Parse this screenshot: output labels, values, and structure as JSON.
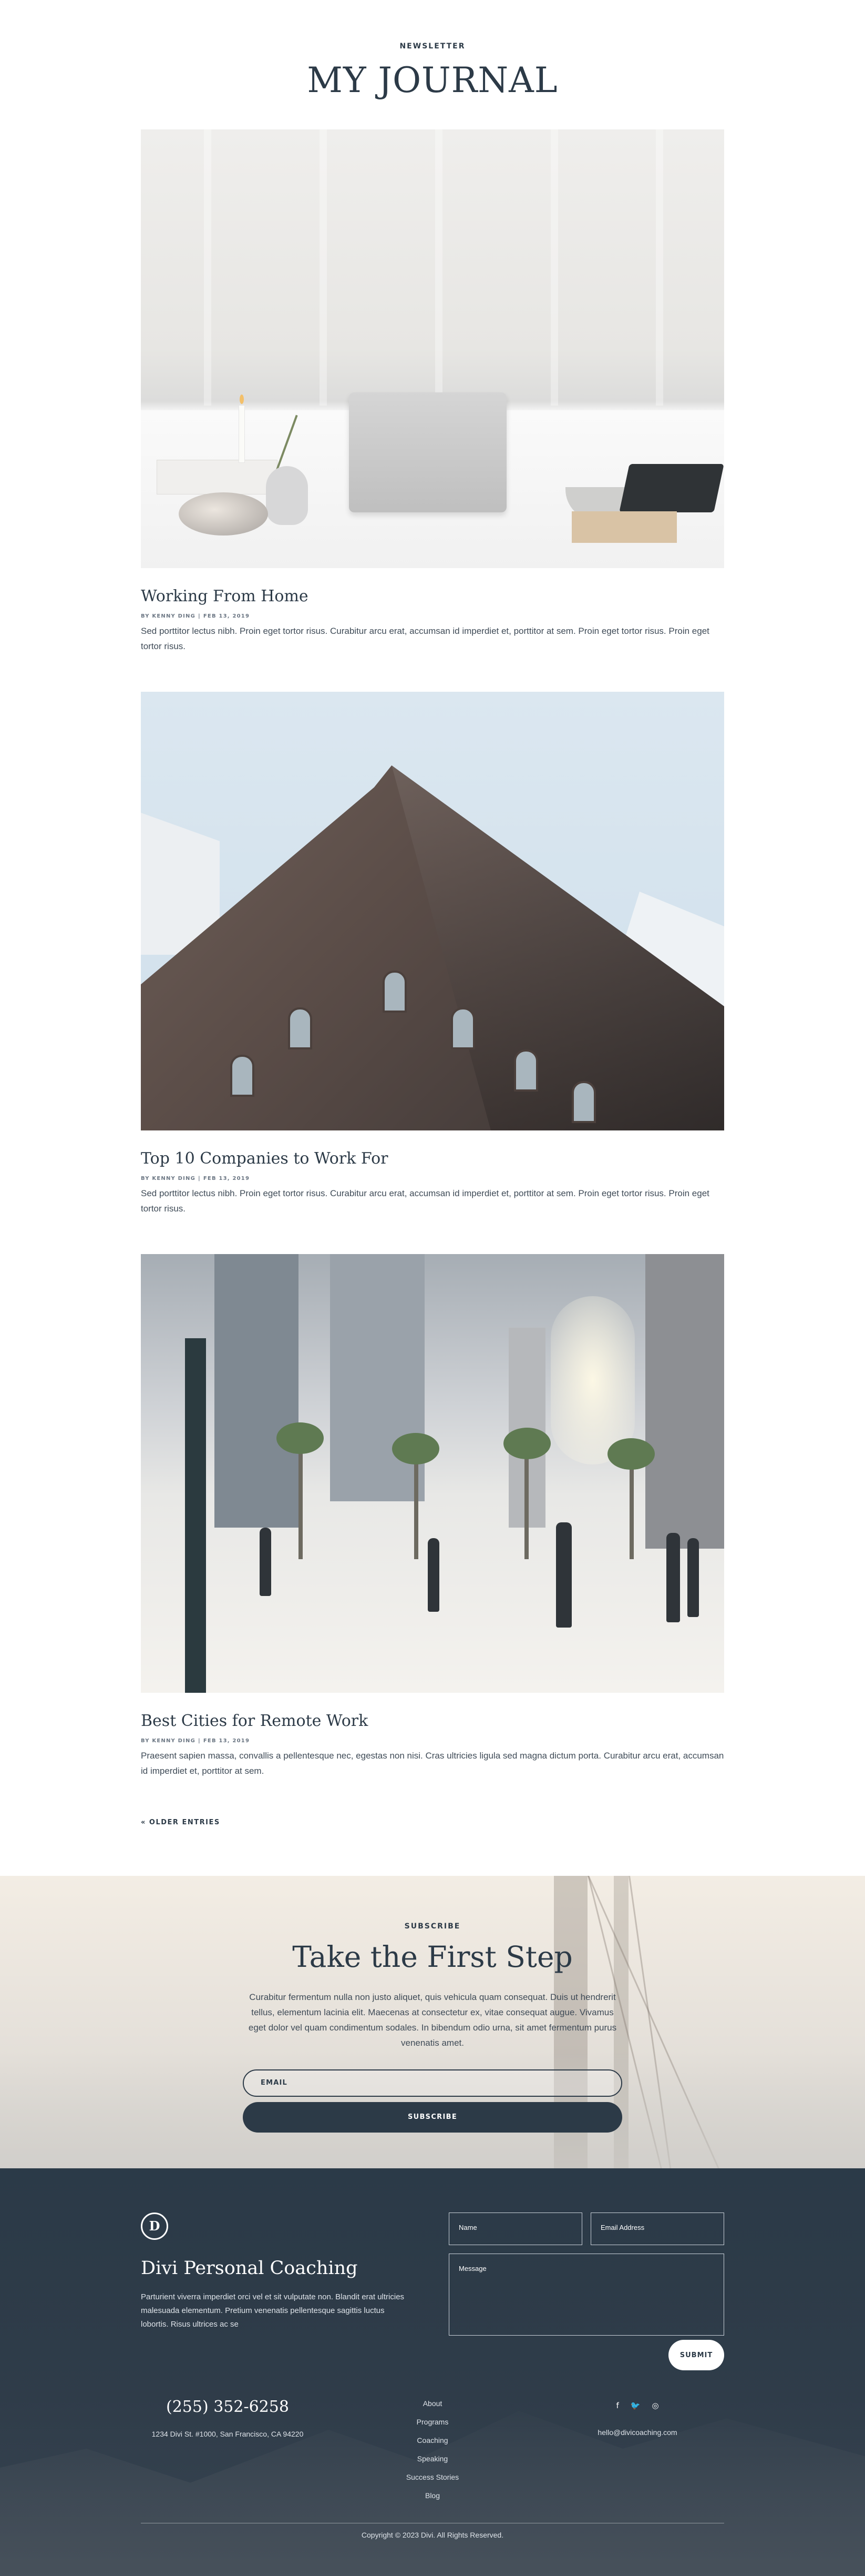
{
  "header": {
    "eyebrow": "NEWSLETTER",
    "title": "MY JOURNAL"
  },
  "posts": [
    {
      "title": "Working From Home",
      "author": "BY KENNY DING",
      "date": "FEB 13, 2019",
      "excerpt": "Sed porttitor lectus nibh. Proin eget tortor risus. Curabitur arcu erat, accumsan id imperdiet et, porttitor at sem. Proin eget tortor risus. Proin eget tortor risus."
    },
    {
      "title": "Top 10 Companies to Work For",
      "author": "BY KENNY DING",
      "date": "FEB 13, 2019",
      "excerpt": "Sed porttitor lectus nibh. Proin eget tortor risus. Curabitur arcu erat, accumsan id imperdiet et, porttitor at sem. Proin eget tortor risus. Proin eget tortor risus."
    },
    {
      "title": "Best Cities for Remote Work",
      "author": "BY KENNY DING",
      "date": "FEB 13, 2019",
      "excerpt": "Praesent sapien massa, convallis a pellentesque nec, egestas non nisi. Cras ultricies ligula sed magna dictum porta. Curabitur arcu erat, accumsan id imperdiet et, porttitor at sem."
    }
  ],
  "meta_separator": "|",
  "pagination": {
    "older_label": "« OLDER ENTRIES"
  },
  "subscribe": {
    "eyebrow": "SUBSCRIBE",
    "title": "Take the First Step",
    "text": "Curabitur fermentum nulla non justo aliquet, quis vehicula quam consequat. Duis ut hendrerit tellus, elementum lacinia elit. Maecenas at consectetur ex, vitae consequat augue. Vivamus eget dolor vel quam condimentum sodales. In bibendum odio urna, sit amet fermentum purus venenatis amet.",
    "email_placeholder": "EMAIL",
    "button_label": "SUBSCRIBE"
  },
  "footer": {
    "logo_letter": "D",
    "brand_name": "Divi Personal Coaching",
    "brand_text": "Parturient viverra imperdiet orci vel et sit vulputate non. Blandit erat ultricies malesuada elementum. Pretium venenatis pellentesque sagittis luctus lobortis. Risus ultrices ac se",
    "form": {
      "name_placeholder": "Name",
      "email_placeholder": "Email Address",
      "message_placeholder": "Message",
      "submit_label": "SUBMIT"
    },
    "phone": "(255) 352-6258",
    "address": "1234 Divi St. #1000, San Francisco, CA 94220",
    "nav": [
      "About",
      "Programs",
      "Coaching",
      "Speaking",
      "Success Stories",
      "Blog"
    ],
    "social_icons": [
      "facebook-icon",
      "twitter-icon",
      "instagram-icon"
    ],
    "social_glyphs": [
      "f",
      "🐦",
      "◎"
    ],
    "email": "hello@divicoaching.com",
    "copyright": "Copyright © 2023 Divi. All Rights Reserved."
  },
  "colors": {
    "primary": "#2c3a47",
    "footer_bg": "#2b3a48",
    "text_muted": "#3f4b57",
    "white": "#ffffff"
  }
}
